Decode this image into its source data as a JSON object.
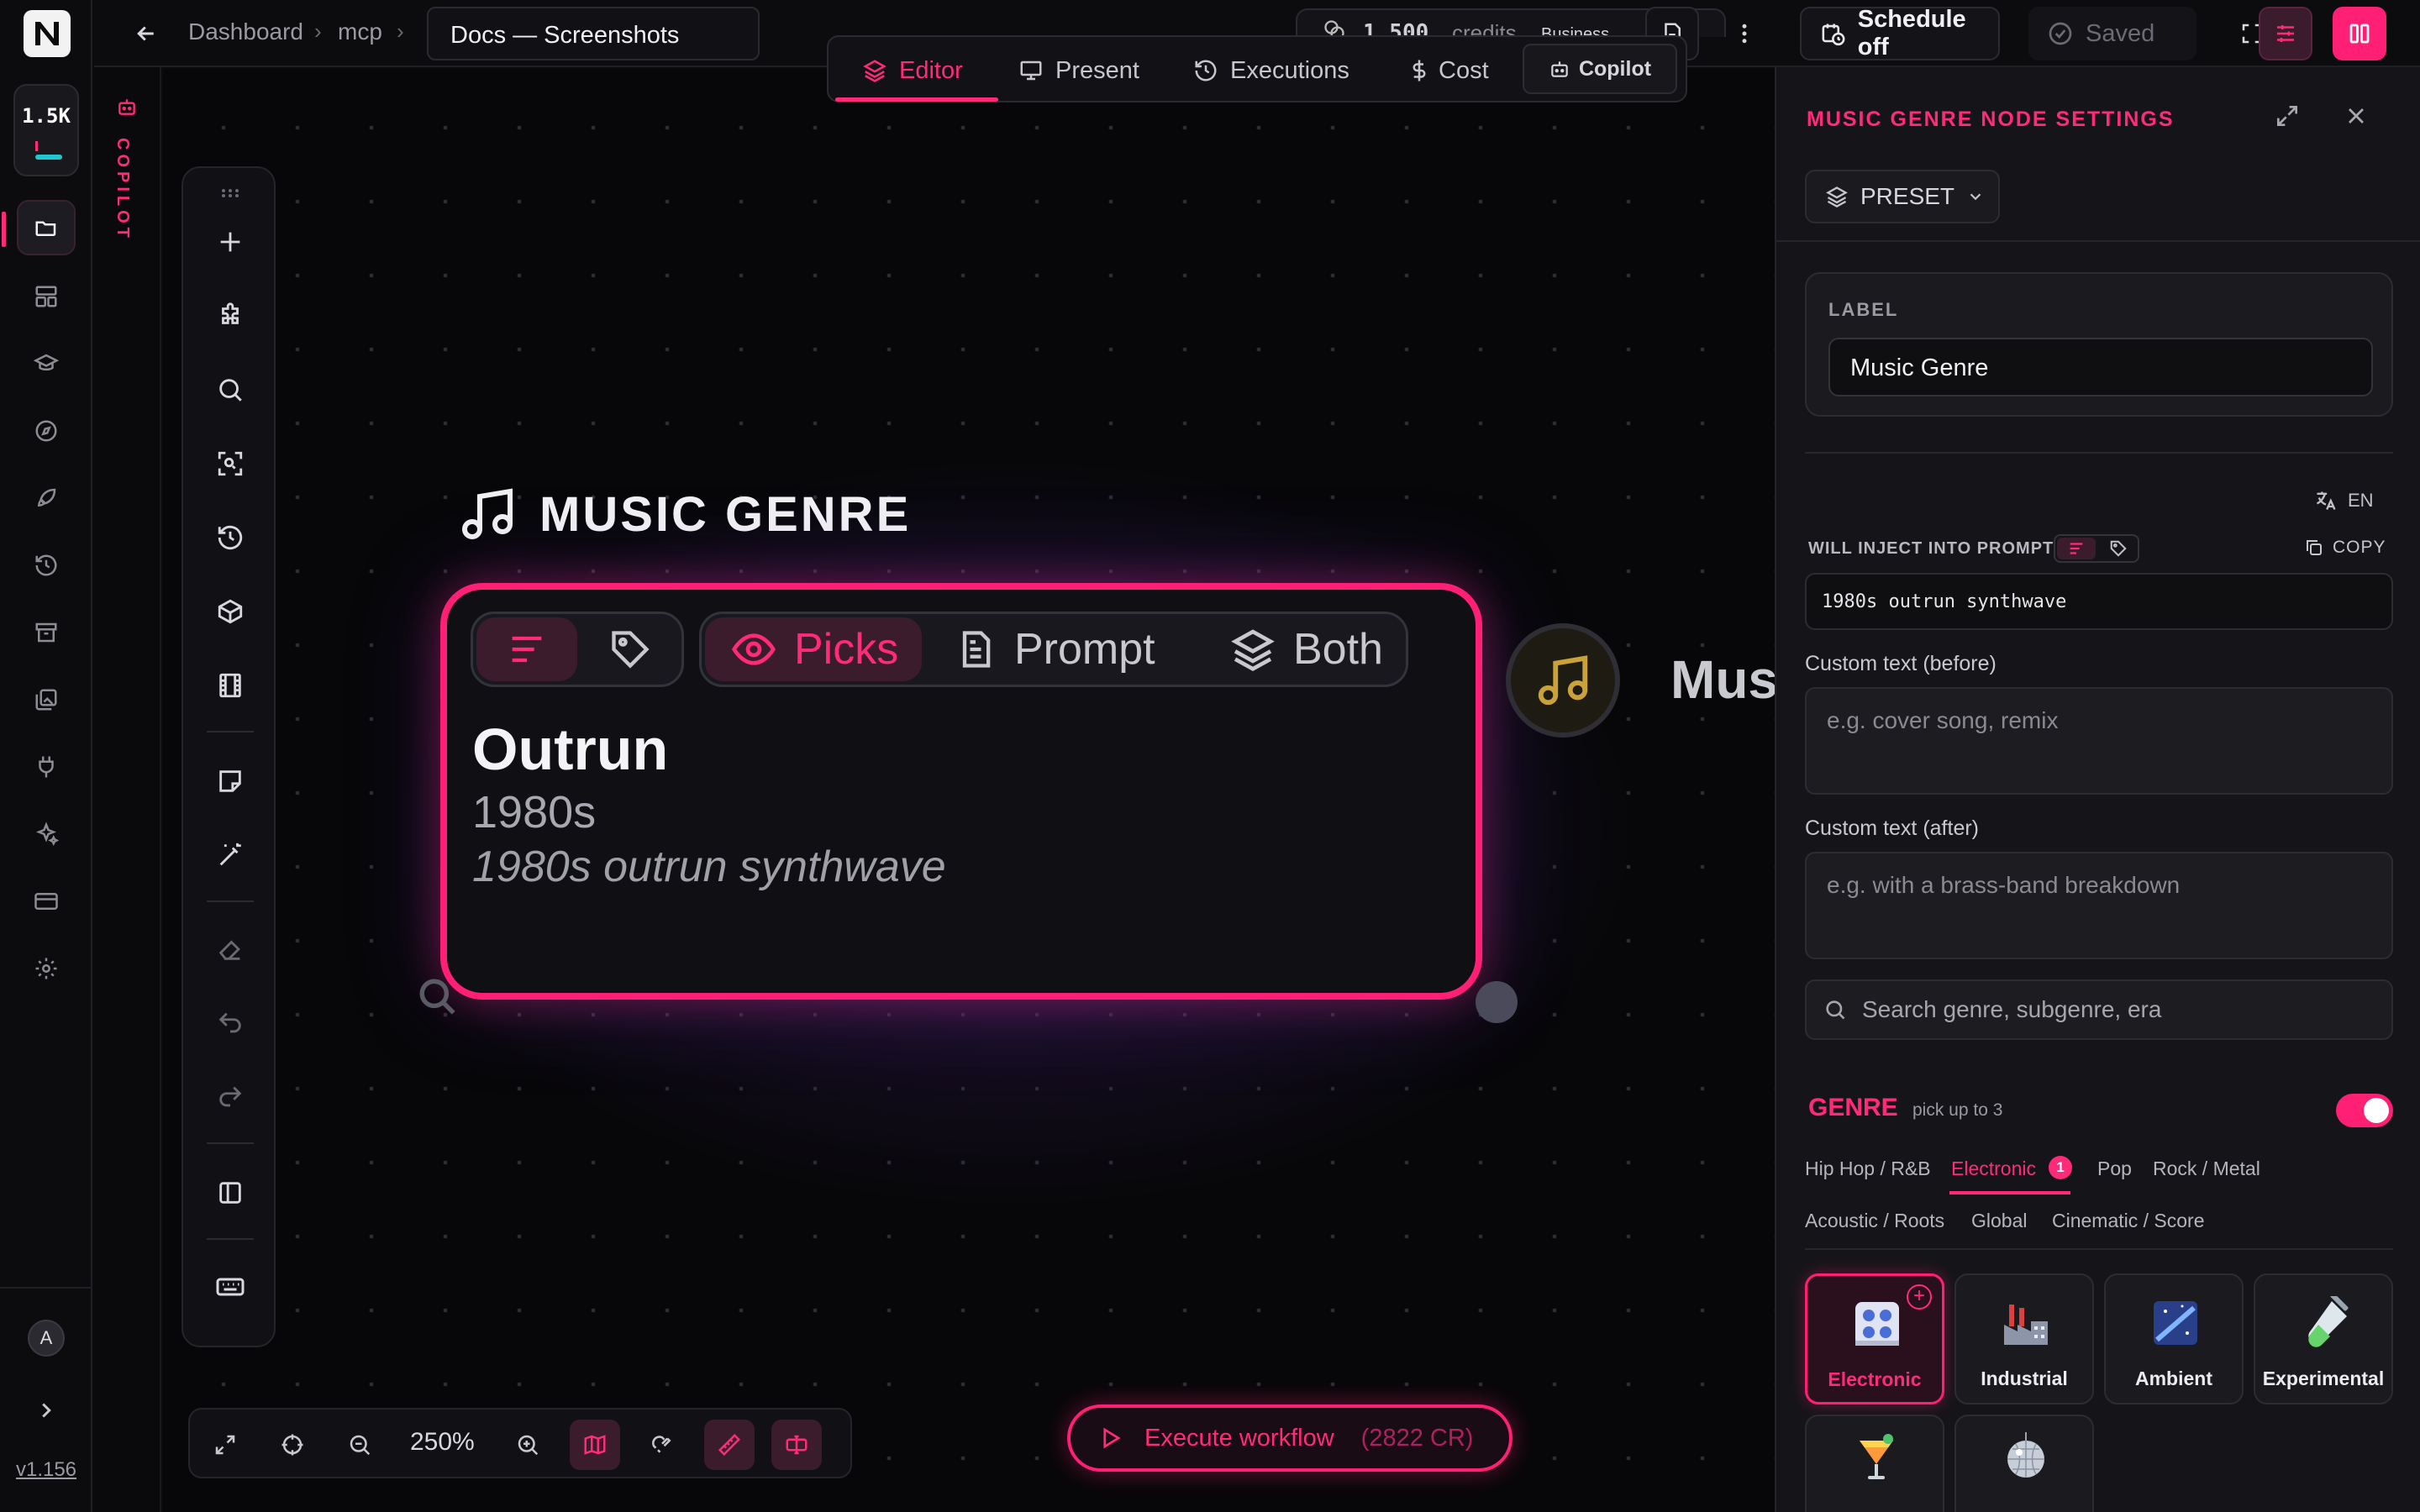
{
  "rail": {
    "credits_short": "1.5K",
    "version": "v1.156",
    "avatar_initial": "A",
    "icons": [
      "folder-open-icon",
      "layout-icon",
      "graduation-cap-icon",
      "compass-icon",
      "rocket-icon",
      "history-icon",
      "archive-icon",
      "images-icon",
      "plug-icon",
      "sparkles-icon",
      "credit-card-icon",
      "settings-icon"
    ]
  },
  "copilot_strip": {
    "label": "COPILOT"
  },
  "topbar": {
    "breadcrumb": [
      "Dashboard",
      "mcp"
    ],
    "doc_title": "Docs — Screenshots",
    "credits_amount": "1,500",
    "credits_label": "credits",
    "plan": "Business",
    "schedule_label": "Schedule off",
    "saved_label": "Saved"
  },
  "mode_tabs": [
    {
      "label": "Editor",
      "icon": "layers-icon",
      "active": true
    },
    {
      "label": "Present",
      "icon": "monitor-icon"
    },
    {
      "label": "Executions",
      "icon": "history-icon"
    },
    {
      "label": "Cost",
      "icon": "dollar-icon"
    },
    {
      "label": "Copilot",
      "icon": "bot-icon"
    }
  ],
  "canvas": {
    "zoom": "250%",
    "node": {
      "title": "MUSIC GENRE",
      "modes": [
        "Picks",
        "Prompt",
        "Both"
      ],
      "pick_title": "Outrun",
      "pick_era": "1980s",
      "pick_prompt": "1980s outrun synthwave"
    },
    "next_node_label": "Musi",
    "execute": {
      "label": "Execute workflow",
      "cost": "(2822 CR)"
    }
  },
  "panel": {
    "title": "MUSIC GENRE NODE SETTINGS",
    "preset_label": "PRESET",
    "label_caption": "LABEL",
    "label_value": "Music Genre",
    "lang": "EN",
    "inject_caption": "WILL INJECT INTO PROMPT",
    "copy_label": "COPY",
    "inject_value": "1980s outrun synthwave",
    "before_label": "Custom text (before)",
    "before_placeholder": "e.g. cover song, remix",
    "after_label": "Custom text (after)",
    "after_placeholder": "e.g. with a brass-band breakdown",
    "search_placeholder": "Search genre, subgenre, era",
    "genre_title": "GENRE",
    "genre_sub": "pick up to 3",
    "categories_row1": [
      "Hip Hop / R&B",
      "Electronic",
      "Pop",
      "Rock / Metal"
    ],
    "categories_row2": [
      "Acoustic / Roots",
      "Global",
      "Cinematic / Score"
    ],
    "active_category_count": "1",
    "genres": [
      "Electronic",
      "Industrial",
      "Ambient",
      "Experimental"
    ]
  },
  "colors": {
    "accent": "#ff1f75",
    "bg": "#0b0b0e",
    "panel": "#151519"
  }
}
